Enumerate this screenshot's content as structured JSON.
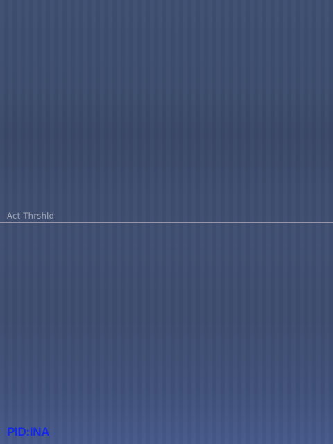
{
  "overlay": {
    "threshold_label": "Act Thrshld",
    "pid_label": "PID:INA"
  },
  "colors": {
    "background": "#3e4e70",
    "threshold_line": "#a99aa6",
    "threshold_label": "#a4a8b6",
    "pid_label": "#1428e6"
  }
}
